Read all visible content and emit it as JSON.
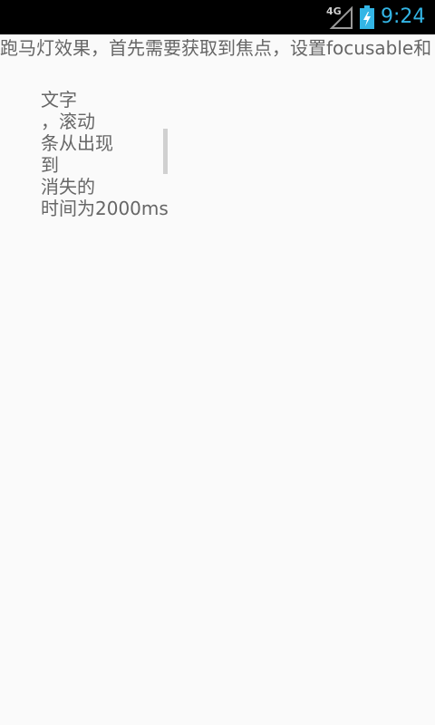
{
  "status_bar": {
    "network_label": "4G",
    "network_icon": "signal-4g-icon",
    "battery_icon": "battery-charging-icon",
    "time": "9:24",
    "accent_color": "#33b5e5"
  },
  "marquee": {
    "text": "跑马灯效果，首先需要获取到焦点，设置focusable和"
  },
  "scroll_text": {
    "lines": [
      "文字",
      "，滚动",
      "条从出现",
      "到",
      "消失的",
      "时间为2000ms"
    ]
  }
}
